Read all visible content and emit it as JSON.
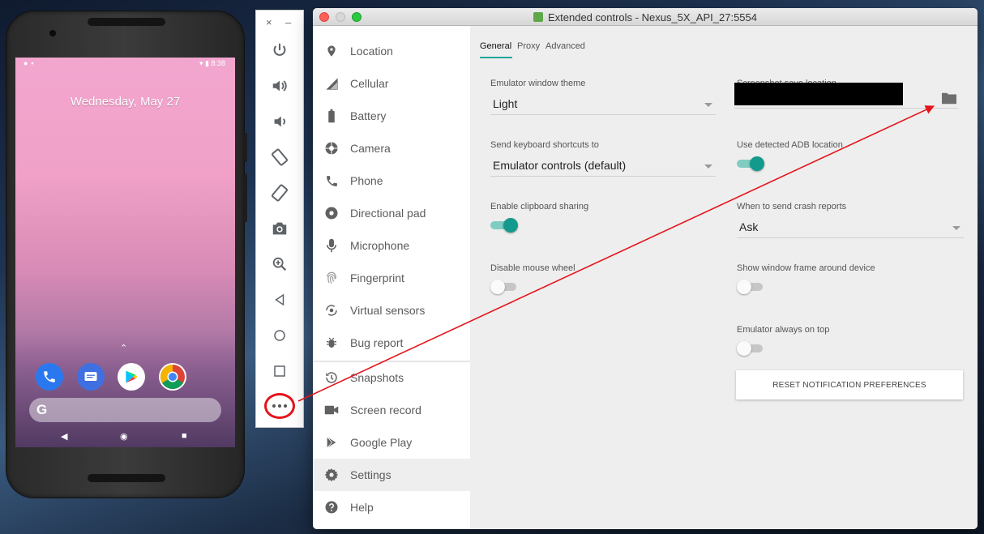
{
  "phone": {
    "status_time": "8:38",
    "date": "Wednesday, May 27",
    "search_glyph": "G",
    "dock_apps": [
      "phone-icon",
      "messages-icon",
      "play-store-icon",
      "chrome-icon"
    ]
  },
  "toolbar": {
    "close_glyph": "×",
    "minimize_glyph": "–",
    "buttons": [
      "power-icon",
      "volume-up-icon",
      "volume-down-icon",
      "rotate-left-icon",
      "rotate-right-icon",
      "camera-icon",
      "zoom-icon",
      "back-icon",
      "home-icon",
      "overview-icon",
      "more-icon"
    ]
  },
  "window": {
    "title": "Extended controls - Nexus_5X_API_27:5554"
  },
  "sidebar": {
    "items": [
      {
        "label": "Location",
        "icon": "location-pin-icon"
      },
      {
        "label": "Cellular",
        "icon": "cellular-signal-icon"
      },
      {
        "label": "Battery",
        "icon": "battery-icon"
      },
      {
        "label": "Camera",
        "icon": "camera-aperture-icon"
      },
      {
        "label": "Phone",
        "icon": "phone-icon"
      },
      {
        "label": "Directional pad",
        "icon": "dpad-icon"
      },
      {
        "label": "Microphone",
        "icon": "microphone-icon"
      },
      {
        "label": "Fingerprint",
        "icon": "fingerprint-icon"
      },
      {
        "label": "Virtual sensors",
        "icon": "virtual-sensors-icon"
      },
      {
        "label": "Bug report",
        "icon": "bug-icon"
      },
      {
        "label": "Snapshots",
        "icon": "history-icon"
      },
      {
        "label": "Screen record",
        "icon": "videocam-icon"
      },
      {
        "label": "Google Play",
        "icon": "google-play-icon"
      },
      {
        "label": "Settings",
        "icon": "gear-icon"
      },
      {
        "label": "Help",
        "icon": "help-icon"
      }
    ],
    "active_item": "Settings"
  },
  "tabs": {
    "general": "General",
    "proxy": "Proxy",
    "advanced": "Advanced",
    "active": "General"
  },
  "settings": {
    "theme_label": "Emulator window theme",
    "theme_value": "Light",
    "shortcuts_label": "Send keyboard shortcuts to",
    "shortcuts_value": "Emulator controls (default)",
    "clipboard_label": "Enable clipboard sharing",
    "clipboard_on": true,
    "mouse_wheel_label": "Disable mouse wheel",
    "mouse_wheel_on": false,
    "screenshot_label": "Screenshot save location",
    "adb_label": "Use detected ADB location",
    "adb_on": true,
    "crash_label": "When to send crash reports",
    "crash_value": "Ask",
    "frame_label": "Show window frame around device",
    "frame_on": false,
    "on_top_label": "Emulator always on top",
    "on_top_on": false,
    "reset_label": "RESET NOTIFICATION PREFERENCES"
  },
  "colors": {
    "accent": "#1aa69a",
    "annotation_red": "#e4141b"
  }
}
